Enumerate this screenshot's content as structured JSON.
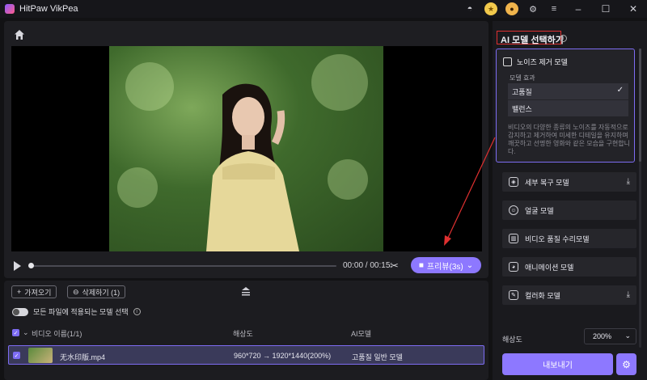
{
  "titlebar": {
    "app_name": "HitPaw VikPea",
    "icons": [
      "discord-icon",
      "coin-icon",
      "avatar-icon",
      "settings-icon",
      "menu-icon"
    ],
    "window_controls": [
      "minimize",
      "maximize",
      "close"
    ]
  },
  "player": {
    "time": "00:00 / 00:15",
    "preview_label": "프리뷰(3s)",
    "progress": 0
  },
  "file_panel": {
    "add_file": "가져오기",
    "delete": "삭제하기 (1)",
    "toggle_label": "모든 파일에 적용되는 모델 선택",
    "columns": {
      "name": "비디오 이름(1/1)",
      "resolution": "해상도",
      "model": "AI모델"
    },
    "row": {
      "file_name": "无水印版.mp4",
      "resolution": "960*720 → 1920*1440(200%)",
      "model": "고품질 일반 모델"
    }
  },
  "ai_panel": {
    "title": "AI 모델 선택하기",
    "selected_model": {
      "name": "노이즈 제거 모델",
      "effect_label": "모델 효과",
      "options": [
        "고품질",
        "밸런스"
      ],
      "selected_option": "고품질",
      "description": "비디오의 다양한 종류의 노이즈를 자동적으로 감지하고 제거하여 미세한 디테일을 유지하며 깨끗하고 선명한 영화와 같은 모습을 구현합니다."
    },
    "models": [
      {
        "name": "세부 복구 모델",
        "icon": "detail-icon",
        "download": true
      },
      {
        "name": "얼굴 모델",
        "icon": "face-icon",
        "download": false
      },
      {
        "name": "비디오 품질 수리모델",
        "icon": "repair-icon",
        "download": false
      },
      {
        "name": "애니메이션 모델",
        "icon": "anime-icon",
        "download": false
      },
      {
        "name": "컬러화 모델",
        "icon": "color-icon",
        "download": true
      }
    ],
    "resolution_label": "해상도",
    "resolution_value": "200%",
    "export_label": "내보내기"
  },
  "colors": {
    "accent": "#8d78ff",
    "highlight_border": "#e03030"
  }
}
